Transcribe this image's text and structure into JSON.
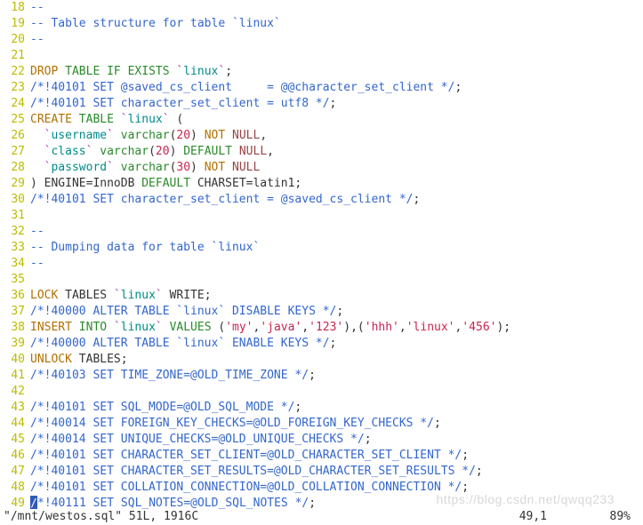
{
  "lines": [
    {
      "num": 18,
      "segments": [
        {
          "cls": "com",
          "t": "--"
        }
      ]
    },
    {
      "num": 19,
      "segments": [
        {
          "cls": "com",
          "t": "-- Table structure for table `linux`"
        }
      ]
    },
    {
      "num": 20,
      "segments": [
        {
          "cls": "com",
          "t": "--"
        }
      ]
    },
    {
      "num": 21,
      "segments": [
        {
          "cls": "plain",
          "t": ""
        }
      ]
    },
    {
      "num": 22,
      "segments": [
        {
          "cls": "stmt",
          "t": "DROP"
        },
        {
          "cls": "plain",
          "t": " "
        },
        {
          "cls": "kw",
          "t": "TABLE"
        },
        {
          "cls": "plain",
          "t": " "
        },
        {
          "cls": "kw",
          "t": "IF"
        },
        {
          "cls": "plain",
          "t": " "
        },
        {
          "cls": "kw",
          "t": "EXISTS"
        },
        {
          "cls": "plain",
          "t": " "
        },
        {
          "cls": "bt",
          "t": "`"
        },
        {
          "cls": "id",
          "t": "linux"
        },
        {
          "cls": "bt",
          "t": "`"
        },
        {
          "cls": "plain",
          "t": ";"
        }
      ]
    },
    {
      "num": 23,
      "segments": [
        {
          "cls": "com",
          "t": "/*!40101 SET @saved_cs_client     = @@character_set_client */"
        },
        {
          "cls": "plain",
          "t": ";"
        }
      ]
    },
    {
      "num": 24,
      "segments": [
        {
          "cls": "com",
          "t": "/*!40101 SET character_set_client = utf8 */"
        },
        {
          "cls": "plain",
          "t": ";"
        }
      ]
    },
    {
      "num": 25,
      "segments": [
        {
          "cls": "stmt",
          "t": "CREATE"
        },
        {
          "cls": "plain",
          "t": " "
        },
        {
          "cls": "kw",
          "t": "TABLE"
        },
        {
          "cls": "plain",
          "t": " "
        },
        {
          "cls": "bt",
          "t": "`"
        },
        {
          "cls": "id",
          "t": "linux"
        },
        {
          "cls": "bt",
          "t": "`"
        },
        {
          "cls": "plain",
          "t": " ("
        }
      ]
    },
    {
      "num": 26,
      "segments": [
        {
          "cls": "plain",
          "t": "  "
        },
        {
          "cls": "bt",
          "t": "`"
        },
        {
          "cls": "id",
          "t": "username"
        },
        {
          "cls": "bt",
          "t": "`"
        },
        {
          "cls": "plain",
          "t": " "
        },
        {
          "cls": "type",
          "t": "varchar"
        },
        {
          "cls": "plain",
          "t": "("
        },
        {
          "cls": "num",
          "t": "20"
        },
        {
          "cls": "plain",
          "t": ") "
        },
        {
          "cls": "notnull",
          "t": "NOT"
        },
        {
          "cls": "plain",
          "t": " "
        },
        {
          "cls": "null",
          "t": "NULL"
        },
        {
          "cls": "plain",
          "t": ","
        }
      ]
    },
    {
      "num": 27,
      "segments": [
        {
          "cls": "plain",
          "t": "  "
        },
        {
          "cls": "bt",
          "t": "`"
        },
        {
          "cls": "id",
          "t": "class"
        },
        {
          "cls": "bt",
          "t": "`"
        },
        {
          "cls": "plain",
          "t": " "
        },
        {
          "cls": "type",
          "t": "varchar"
        },
        {
          "cls": "plain",
          "t": "("
        },
        {
          "cls": "num",
          "t": "20"
        },
        {
          "cls": "plain",
          "t": ") "
        },
        {
          "cls": "kw",
          "t": "DEFAULT"
        },
        {
          "cls": "plain",
          "t": " "
        },
        {
          "cls": "null",
          "t": "NULL"
        },
        {
          "cls": "plain",
          "t": ","
        }
      ]
    },
    {
      "num": 28,
      "segments": [
        {
          "cls": "plain",
          "t": "  "
        },
        {
          "cls": "bt",
          "t": "`"
        },
        {
          "cls": "id",
          "t": "password"
        },
        {
          "cls": "bt",
          "t": "`"
        },
        {
          "cls": "plain",
          "t": " "
        },
        {
          "cls": "type",
          "t": "varchar"
        },
        {
          "cls": "plain",
          "t": "("
        },
        {
          "cls": "num",
          "t": "30"
        },
        {
          "cls": "plain",
          "t": ") "
        },
        {
          "cls": "notnull",
          "t": "NOT"
        },
        {
          "cls": "plain",
          "t": " "
        },
        {
          "cls": "null",
          "t": "NULL"
        }
      ]
    },
    {
      "num": 29,
      "segments": [
        {
          "cls": "plain",
          "t": ") ENGINE=InnoDB "
        },
        {
          "cls": "kw",
          "t": "DEFAULT"
        },
        {
          "cls": "plain",
          "t": " CHARSET=latin1;"
        }
      ]
    },
    {
      "num": 30,
      "segments": [
        {
          "cls": "com",
          "t": "/*!40101 SET character_set_client = @saved_cs_client */"
        },
        {
          "cls": "plain",
          "t": ";"
        }
      ]
    },
    {
      "num": 31,
      "segments": [
        {
          "cls": "plain",
          "t": ""
        }
      ]
    },
    {
      "num": 32,
      "segments": [
        {
          "cls": "com",
          "t": "--"
        }
      ]
    },
    {
      "num": 33,
      "segments": [
        {
          "cls": "com",
          "t": "-- Dumping data for table `linux`"
        }
      ]
    },
    {
      "num": 34,
      "segments": [
        {
          "cls": "com",
          "t": "--"
        }
      ]
    },
    {
      "num": 35,
      "segments": [
        {
          "cls": "plain",
          "t": ""
        }
      ]
    },
    {
      "num": 36,
      "segments": [
        {
          "cls": "stmt",
          "t": "LOCK"
        },
        {
          "cls": "plain",
          "t": " TABLES "
        },
        {
          "cls": "bt",
          "t": "`"
        },
        {
          "cls": "id",
          "t": "linux"
        },
        {
          "cls": "bt",
          "t": "`"
        },
        {
          "cls": "plain",
          "t": " WRITE;"
        }
      ]
    },
    {
      "num": 37,
      "segments": [
        {
          "cls": "com",
          "t": "/*!40000 ALTER TABLE `linux` DISABLE KEYS */"
        },
        {
          "cls": "plain",
          "t": ";"
        }
      ]
    },
    {
      "num": 38,
      "segments": [
        {
          "cls": "stmt",
          "t": "INSERT"
        },
        {
          "cls": "plain",
          "t": " "
        },
        {
          "cls": "kw",
          "t": "INTO"
        },
        {
          "cls": "plain",
          "t": " "
        },
        {
          "cls": "bt",
          "t": "`"
        },
        {
          "cls": "id",
          "t": "linux"
        },
        {
          "cls": "bt",
          "t": "`"
        },
        {
          "cls": "plain",
          "t": " "
        },
        {
          "cls": "kw",
          "t": "VALUES"
        },
        {
          "cls": "plain",
          "t": " ("
        },
        {
          "cls": "str",
          "t": "'my'"
        },
        {
          "cls": "plain",
          "t": ","
        },
        {
          "cls": "str",
          "t": "'java'"
        },
        {
          "cls": "plain",
          "t": ","
        },
        {
          "cls": "str",
          "t": "'123'"
        },
        {
          "cls": "plain",
          "t": "),("
        },
        {
          "cls": "str",
          "t": "'hhh'"
        },
        {
          "cls": "plain",
          "t": ","
        },
        {
          "cls": "str",
          "t": "'linux'"
        },
        {
          "cls": "plain",
          "t": ","
        },
        {
          "cls": "str",
          "t": "'456'"
        },
        {
          "cls": "plain",
          "t": ");"
        }
      ]
    },
    {
      "num": 39,
      "segments": [
        {
          "cls": "com",
          "t": "/*!40000 ALTER TABLE `linux` ENABLE KEYS */"
        },
        {
          "cls": "plain",
          "t": ";"
        }
      ]
    },
    {
      "num": 40,
      "segments": [
        {
          "cls": "stmt",
          "t": "UNLOCK"
        },
        {
          "cls": "plain",
          "t": " TABLES;"
        }
      ]
    },
    {
      "num": 41,
      "segments": [
        {
          "cls": "com",
          "t": "/*!40103 SET TIME_ZONE=@OLD_TIME_ZONE */"
        },
        {
          "cls": "plain",
          "t": ";"
        }
      ]
    },
    {
      "num": 42,
      "segments": [
        {
          "cls": "plain",
          "t": ""
        }
      ]
    },
    {
      "num": 43,
      "segments": [
        {
          "cls": "com",
          "t": "/*!40101 SET SQL_MODE=@OLD_SQL_MODE */"
        },
        {
          "cls": "plain",
          "t": ";"
        }
      ]
    },
    {
      "num": 44,
      "segments": [
        {
          "cls": "com",
          "t": "/*!40014 SET FOREIGN_KEY_CHECKS=@OLD_FOREIGN_KEY_CHECKS */"
        },
        {
          "cls": "plain",
          "t": ";"
        }
      ]
    },
    {
      "num": 45,
      "segments": [
        {
          "cls": "com",
          "t": "/*!40014 SET UNIQUE_CHECKS=@OLD_UNIQUE_CHECKS */"
        },
        {
          "cls": "plain",
          "t": ";"
        }
      ]
    },
    {
      "num": 46,
      "segments": [
        {
          "cls": "com",
          "t": "/*!40101 SET CHARACTER_SET_CLIENT=@OLD_CHARACTER_SET_CLIENT */"
        },
        {
          "cls": "plain",
          "t": ";"
        }
      ]
    },
    {
      "num": 47,
      "segments": [
        {
          "cls": "com",
          "t": "/*!40101 SET CHARACTER_SET_RESULTS=@OLD_CHARACTER_SET_RESULTS */"
        },
        {
          "cls": "plain",
          "t": ";"
        }
      ]
    },
    {
      "num": 48,
      "segments": [
        {
          "cls": "com",
          "t": "/*!40101 SET COLLATION_CONNECTION=@OLD_COLLATION_CONNECTION */"
        },
        {
          "cls": "plain",
          "t": ";"
        }
      ]
    },
    {
      "num": 49,
      "cursor": true,
      "segments": [
        {
          "cls": "com",
          "t": "*!40111 SET SQL_NOTES=@OLD_SQL_NOTES */"
        },
        {
          "cls": "plain",
          "t": ";"
        }
      ]
    }
  ],
  "status": {
    "filename": "\"/mnt/westos.sql\" 51L, 1916C",
    "position": "49,1",
    "percent": "89%"
  },
  "watermark": "https://blog.csdn.net/qwqq233"
}
